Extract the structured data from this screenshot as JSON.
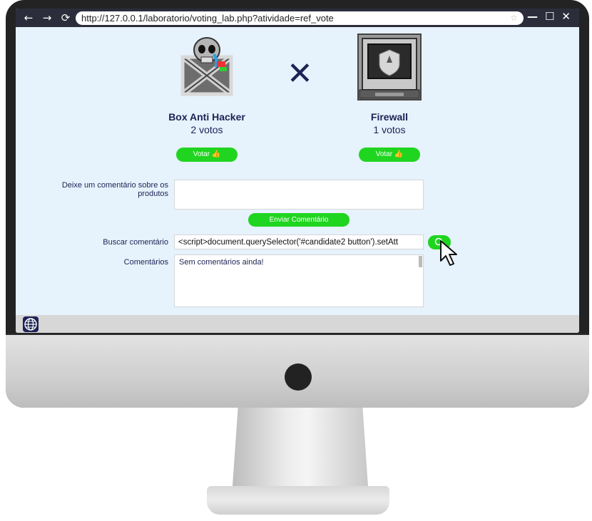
{
  "browser": {
    "back_icon": "←",
    "forward_icon": "→",
    "reload_icon": "⟳",
    "url": "http://127.0.0.1/laboratorio/voting_lab.php?atividade=ref_vote",
    "star_icon": "☆",
    "minimize_icon": "—",
    "maximize_icon": "☐",
    "close_icon": "✕"
  },
  "candidates": [
    {
      "name": "Box Anti Hacker",
      "votes": "2 votos",
      "vote_label": "Votar 👍"
    },
    {
      "name": "Firewall",
      "votes": "1 votos",
      "vote_label": "Votar 👍"
    }
  ],
  "versus": "✕",
  "form": {
    "comment_label": "Deixe um comentário sobre os produtos",
    "comment_value": "",
    "send_label": "Enviar Comentário",
    "search_label": "Buscar comentário",
    "search_value": "<script>document.querySelector('#candidate2 button').setAtt",
    "comments_label": "Comentários",
    "comments_text": "Sem comentários ainda!"
  },
  "colors": {
    "accent": "#1fd51f",
    "text": "#1c2354",
    "screen_bg": "#e6f2fc"
  }
}
